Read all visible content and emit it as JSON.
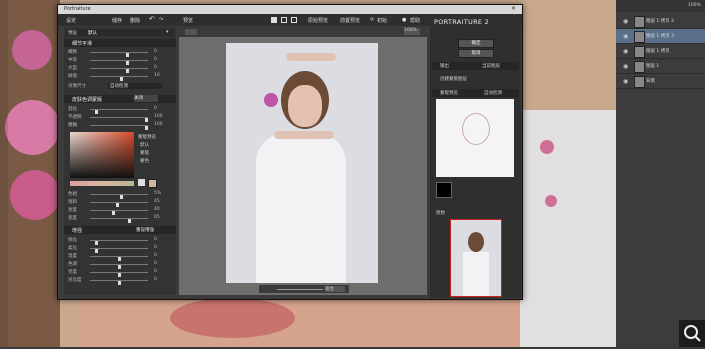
{
  "window": {
    "title": "Portraiture",
    "close_glyph": "×"
  },
  "toolbar": {
    "settings_label": "设定",
    "save_label": "储存",
    "delete_label": "删除",
    "preview_label": "预览",
    "original_label": "原始预览",
    "compare_label": "前置预览",
    "reset_label": "初始",
    "help_label": "帮助",
    "zoom_pct": "100%"
  },
  "left_panel": {
    "preset_label": "预设",
    "preset_value": "默认",
    "detail_section": "细节平滑",
    "detail_sliders": [
      {
        "label": "细致",
        "value": "0"
      },
      {
        "label": "中等",
        "value": "0"
      },
      {
        "label": "大型",
        "value": "0"
      },
      {
        "label": "阀值",
        "value": "10"
      }
    ],
    "portrait_size_label": "肖像尺寸",
    "portrait_size_value": "自动检测",
    "skin_section": "皮肤色调蒙版",
    "skin_dropdown": "关闭",
    "skin_sliders": [
      {
        "label": "羽化",
        "value": "0"
      },
      {
        "label": "不透明",
        "value": "100"
      },
      {
        "label": "模糊",
        "value": "100"
      }
    ],
    "mask_display_label": "蒙版预览",
    "mask_options": [
      "默认",
      "蒙版",
      "蒙色"
    ],
    "color_sliders": [
      {
        "label": "色相",
        "value": "5%"
      },
      {
        "label": "饱和",
        "value": "45"
      },
      {
        "label": "亮度",
        "value": "40"
      },
      {
        "label": "宽度",
        "value": "65"
      }
    ],
    "enhance_section": "增强",
    "enhance_reset": "重设增强",
    "enhance_sliders": [
      {
        "label": "锐化",
        "value": "0"
      },
      {
        "label": "柔化",
        "value": "0"
      },
      {
        "label": "温度",
        "value": "0"
      },
      {
        "label": "色调",
        "value": "0"
      },
      {
        "label": "亮度",
        "value": "0"
      },
      {
        "label": "对比度",
        "value": "0"
      }
    ]
  },
  "preview": {
    "heading": "预览",
    "zoom_value": "100%",
    "footer_zoom": "适合"
  },
  "right_panel": {
    "logo": "PORTRAITURE 2",
    "ok_label": "确定",
    "cancel_label": "取消",
    "output_label": "输出",
    "output_value": "当前图层",
    "create_mask_label": "创建蒙版图层",
    "mask_preview_label": "蒙版预览",
    "mask_auto_label": "自动检测",
    "original_thumb_label": "原始"
  },
  "layers": [
    {
      "name": "图层 1 拷贝 2"
    },
    {
      "name": "图层 1 拷贝 3"
    },
    {
      "name": "图层 1 拷贝"
    },
    {
      "name": "图层 1"
    },
    {
      "name": "背景"
    }
  ],
  "colors": {
    "accent_red": "#cc2222",
    "panel_dark": "#2f2f2f"
  }
}
